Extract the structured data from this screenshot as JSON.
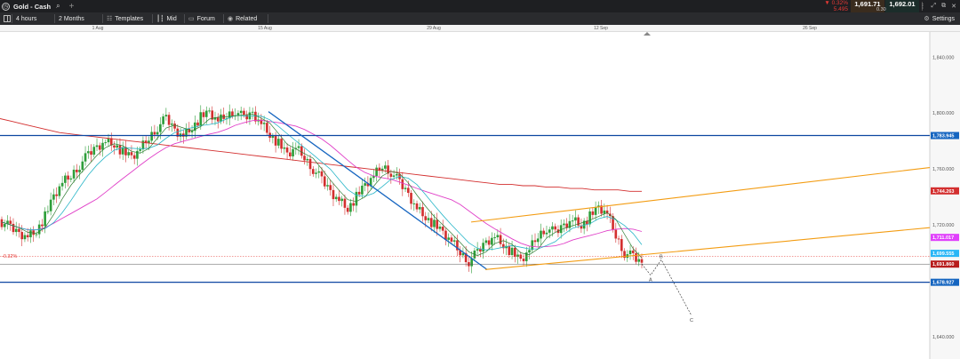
{
  "titlebar": {
    "app_icon": "clock-icon",
    "title": "Gold - Cash",
    "search_icon": "search-icon",
    "add_tab_icon": "plus-icon"
  },
  "quote": {
    "change_pct": "▼ 0.32%",
    "change_abs": "5.495",
    "sell": "1,691.71",
    "spread": "0.30",
    "buy": "1,692.01"
  },
  "window": {
    "controls": [
      "⋮",
      "⤢",
      "⧉",
      "✕"
    ]
  },
  "toolbar": {
    "layout_icon": "layout-grid-icon",
    "interval": "4 hours",
    "range": "2 Months",
    "templates_label": "Templates",
    "mid_label": "Mid",
    "forum_label": "Forum",
    "related_label": "Related",
    "settings_label": "Settings"
  },
  "dateaxis": {
    "labels": [
      "1 Aug",
      "15 Aug",
      "29 Aug",
      "12 Sep",
      "26 Sep"
    ]
  },
  "colors": {
    "background": "#ffffff",
    "candle_up": "#2e9e3a",
    "candle_down": "#d32f2f",
    "ma_slow": "#d32f2f",
    "ma_mid": "#e040c8",
    "ma_fast": "#29b6c8",
    "ma_fastest": "#2e7d32",
    "trend_blue": "#1565c0",
    "channel_orange": "#f39c12",
    "h_line_blue": "#0d47a1"
  },
  "chart_data": {
    "type": "candlestick",
    "title": "",
    "instrument": "Gold - Cash",
    "interval": "4 hours",
    "x_labels": [
      "1 Aug",
      "15 Aug",
      "29 Aug",
      "12 Sep",
      "26 Sep"
    ],
    "y_axis": {
      "ticks": [
        "1,840.000",
        "1,800.000",
        "1,760.000",
        "1,720.000",
        "1,640.000"
      ],
      "tick_values": [
        1840,
        1800,
        1760,
        1720,
        1640
      ],
      "range": [
        1624,
        1858
      ]
    },
    "price_tags": [
      {
        "label": "1,783.945",
        "value": 1783.9,
        "color": "#1565c0",
        "text_color": "#ffffff"
      },
      {
        "label": "1,744.263",
        "value": 1744.3,
        "color": "#d32f2f",
        "text_color": "#ffffff"
      },
      {
        "label": "1,711.017",
        "value": 1711.0,
        "color": "#e040fb",
        "text_color": "#ffffff"
      },
      {
        "label": "1,699.555",
        "value": 1699.6,
        "color": "#29b6f6",
        "text_color": "#ffffff"
      },
      {
        "label": "1,691.860",
        "value": 1691.9,
        "color": "#b71c1c",
        "text_color": "#ffffff"
      },
      {
        "label": "1,678.927",
        "value": 1678.9,
        "color": "#1565c0",
        "text_color": "#ffffff"
      }
    ],
    "change_label": "-0.32%",
    "annotations": [
      {
        "text": "A",
        "series": "projection"
      },
      {
        "text": "B",
        "series": "projection"
      },
      {
        "text": "C",
        "series": "projection"
      }
    ],
    "horizontal_lines": [
      1783.9,
      1678.9
    ],
    "close_series": [
      1722,
      1718,
      1714,
      1712,
      1716,
      1726,
      1740,
      1750,
      1755,
      1763,
      1770,
      1776,
      1780,
      1778,
      1772,
      1768,
      1774,
      1782,
      1790,
      1796,
      1788,
      1784,
      1790,
      1797,
      1800,
      1794,
      1798,
      1802,
      1796,
      1800,
      1793,
      1785,
      1778,
      1770,
      1775,
      1768,
      1760,
      1752,
      1744,
      1738,
      1732,
      1740,
      1748,
      1755,
      1762,
      1758,
      1750,
      1742,
      1732,
      1726,
      1720,
      1714,
      1708,
      1700,
      1694,
      1700,
      1708,
      1712,
      1706,
      1700,
      1694,
      1702,
      1712,
      1718,
      1714,
      1720,
      1724,
      1720,
      1726,
      1732,
      1728,
      1712,
      1700,
      1697,
      1692
    ],
    "ma_slow": [
      1796,
      1794,
      1792,
      1790,
      1788,
      1786,
      1785,
      1784,
      1783,
      1782,
      1781,
      1780,
      1779,
      1778,
      1777,
      1776,
      1775,
      1774,
      1773,
      1772,
      1771,
      1770,
      1769,
      1768,
      1767,
      1766,
      1765,
      1764,
      1763,
      1762,
      1761,
      1760,
      1759,
      1758,
      1757,
      1756,
      1755,
      1754,
      1753,
      1752,
      1751,
      1750,
      1749,
      1749,
      1748,
      1748,
      1747,
      1747,
      1746,
      1746,
      1745,
      1745,
      1745,
      1744,
      1744
    ],
    "channel": {
      "upper": [
        1722,
        1761
      ],
      "lower": [
        1688,
        1718
      ]
    },
    "projection": [
      1692,
      1684,
      1695,
      1655
    ]
  }
}
